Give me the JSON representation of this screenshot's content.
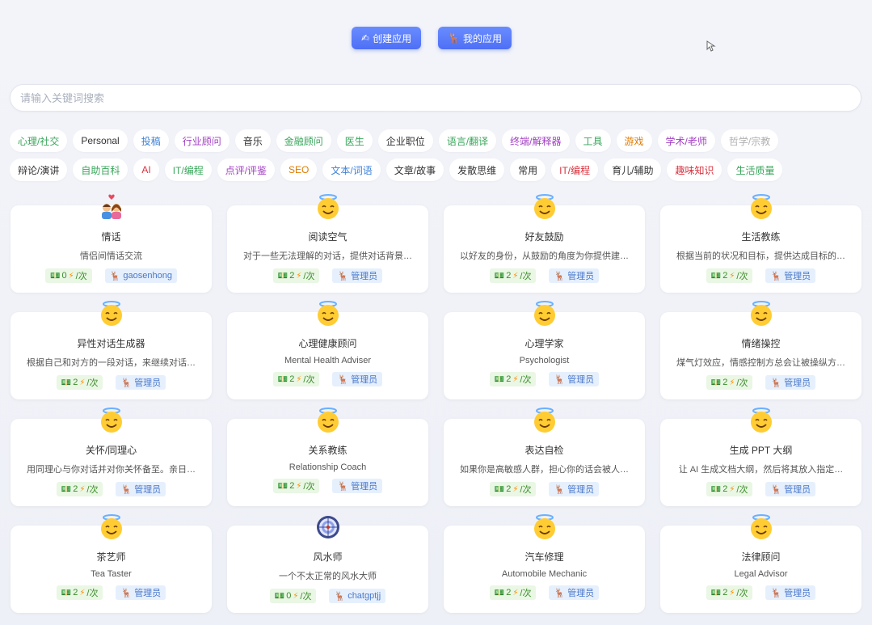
{
  "top_buttons": {
    "create_label": "创建应用",
    "create_icon": "writing-hand",
    "mine_label": "我的应用",
    "mine_icon": "deer"
  },
  "search": {
    "placeholder": "请输入关键词搜索"
  },
  "tags_row1": [
    {
      "label": "心理/社交",
      "color": "#3aa65b"
    },
    {
      "label": "Personal",
      "color": "#333333"
    },
    {
      "label": "投稿",
      "color": "#3f82d8"
    },
    {
      "label": "行业顾问",
      "color": "#a23ec3"
    },
    {
      "label": "音乐",
      "color": "#333333"
    },
    {
      "label": "金融顾问",
      "color": "#3aa65b"
    },
    {
      "label": "医生",
      "color": "#3aa65b"
    },
    {
      "label": "企业职位",
      "color": "#333333"
    },
    {
      "label": "语言/翻译",
      "color": "#3aa65b"
    },
    {
      "label": "终端/解释器",
      "color": "#a23ec3"
    },
    {
      "label": "工具",
      "color": "#3aa65b"
    },
    {
      "label": "游戏",
      "color": "#e07b00"
    },
    {
      "label": "学术/老师",
      "color": "#a23ec3"
    },
    {
      "label": "哲学/宗教",
      "color": "#b0b0b0"
    }
  ],
  "tags_row2": [
    {
      "label": "辩论/演讲",
      "color": "#333333"
    },
    {
      "label": "自助百科",
      "color": "#3aa65b"
    },
    {
      "label": "AI",
      "color": "#d9333f"
    },
    {
      "label": "IT/编程",
      "color": "#3aa65b"
    },
    {
      "label": "点评/评鉴",
      "color": "#a23ec3"
    },
    {
      "label": "SEO",
      "color": "#e07b00"
    },
    {
      "label": "文本/词语",
      "color": "#3f82d8"
    },
    {
      "label": "文章/故事",
      "color": "#333333"
    },
    {
      "label": "发散思维",
      "color": "#333333"
    },
    {
      "label": "常用",
      "color": "#333333"
    },
    {
      "label": "IT/编程",
      "color": "#d9333f"
    },
    {
      "label": "育儿/辅助",
      "color": "#333333"
    },
    {
      "label": "趣味知识",
      "color": "#d9333f"
    },
    {
      "label": "生活质量",
      "color": "#3aa65b"
    }
  ],
  "cards": [
    {
      "title": "情话",
      "desc": "情侣间情话交流",
      "price": "0",
      "unit": "/次",
      "author": "gaosenhong",
      "avatar": "couple-icon"
    },
    {
      "title": "阅读空气",
      "desc": "对于一些无法理解的对话，提供对话背景…",
      "price": "2",
      "unit": "/次",
      "author": "管理员",
      "avatar": "halo-smile-icon"
    },
    {
      "title": "好友鼓励",
      "desc": "以好友的身份，从鼓励的角度为你提供建…",
      "price": "2",
      "unit": "/次",
      "author": "管理员",
      "avatar": "halo-smile-icon"
    },
    {
      "title": "生活教练",
      "desc": "根据当前的状况和目标，提供达成目标的…",
      "price": "2",
      "unit": "/次",
      "author": "管理员",
      "avatar": "halo-smile-icon"
    },
    {
      "title": "异性对话生成器",
      "desc": "根据自己和对方的一段对话，来继续对话…",
      "price": "2",
      "unit": "/次",
      "author": "管理员",
      "avatar": "halo-smile-icon"
    },
    {
      "title": "心理健康顾问",
      "desc": "Mental Health Adviser",
      "price": "2",
      "unit": "/次",
      "author": "管理员",
      "avatar": "halo-smile-icon"
    },
    {
      "title": "心理学家",
      "desc": "Psychologist",
      "price": "2",
      "unit": "/次",
      "author": "管理员",
      "avatar": "halo-smile-icon"
    },
    {
      "title": "情绪操控",
      "desc": "煤气灯效应，情感控制方总会让被操纵方…",
      "price": "2",
      "unit": "/次",
      "author": "管理员",
      "avatar": "halo-smile-icon"
    },
    {
      "title": "关怀/同理心",
      "desc": "用同理心与你对话并对你关怀备至。亲日…",
      "price": "2",
      "unit": "/次",
      "author": "管理员",
      "avatar": "halo-smile-icon"
    },
    {
      "title": "关系教练",
      "desc": "Relationship Coach",
      "price": "2",
      "unit": "/次",
      "author": "管理员",
      "avatar": "halo-smile-icon"
    },
    {
      "title": "表达自检",
      "desc": "如果你是高敏感人群，担心你的话会被人…",
      "price": "2",
      "unit": "/次",
      "author": "管理员",
      "avatar": "halo-smile-icon"
    },
    {
      "title": "生成 PPT 大纲",
      "desc": "让 AI 生成文档大纲，然后将其放入指定…",
      "price": "2",
      "unit": "/次",
      "author": "管理员",
      "avatar": "halo-smile-icon"
    },
    {
      "title": "茶艺师",
      "desc": "Tea Taster",
      "price": "2",
      "unit": "/次",
      "author": "管理员",
      "avatar": "halo-smile-icon"
    },
    {
      "title": "风水师",
      "desc": "一个不太正常的风水大师",
      "price": "0",
      "unit": "/次",
      "author": "chatgptjj",
      "avatar": "compass-icon"
    },
    {
      "title": "汽车修理",
      "desc": "Automobile Mechanic",
      "price": "2",
      "unit": "/次",
      "author": "管理员",
      "avatar": "halo-smile-icon"
    },
    {
      "title": "法律顾问",
      "desc": "Legal Advisor",
      "price": "2",
      "unit": "/次",
      "author": "管理员",
      "avatar": "halo-smile-icon"
    }
  ]
}
